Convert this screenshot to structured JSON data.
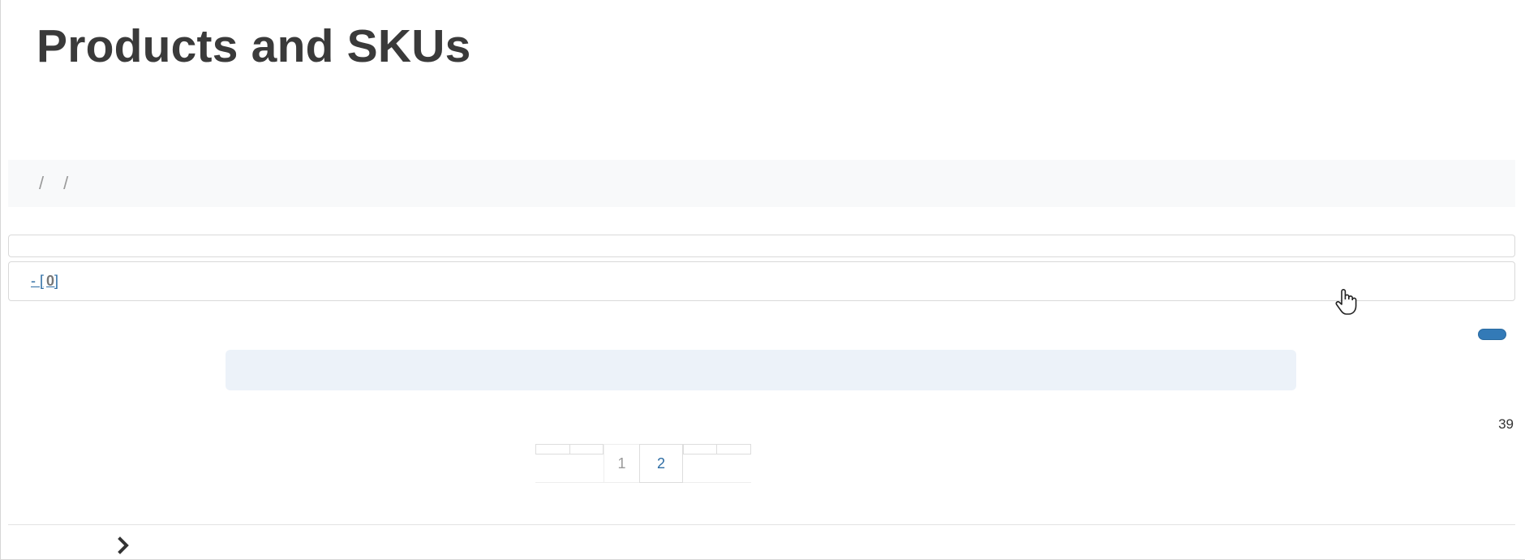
{
  "page": {
    "title": "Products and SKUs"
  },
  "breadcrumb": {
    "separators": [
      "/",
      "/"
    ]
  },
  "filter": {
    "link_label": "-",
    "count_open": "[",
    "count_value": "0",
    "count_close": "]"
  },
  "results": {
    "total_count": "39"
  },
  "pagination": {
    "pages": [
      "1",
      "2"
    ],
    "current_page": "2"
  },
  "icons": {
    "cursor": "hand-pointer-icon",
    "chevron": "chevron-right-icon"
  },
  "colors": {
    "link": "#2e6da4",
    "primary_button": "#337ab7",
    "info_bar": "#ecf2f9",
    "breadcrumb_bg": "#f8f9fa"
  }
}
